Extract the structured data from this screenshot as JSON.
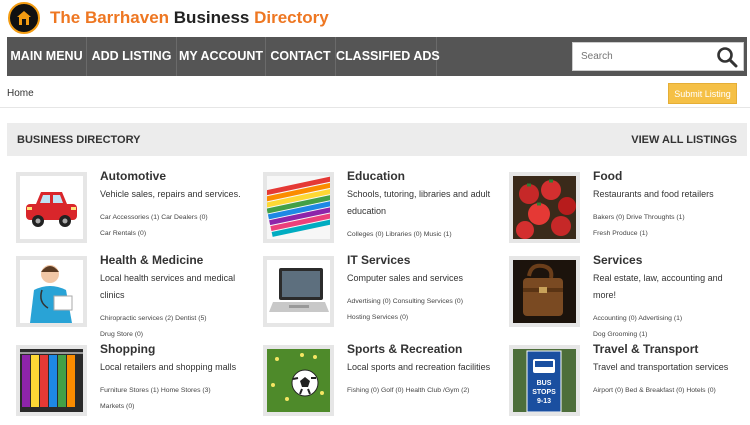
{
  "brand": {
    "title_part1": "The Barrhaven",
    "title_part2": "Business",
    "title_part3": "Directory",
    "colors": {
      "accent": "#ee7722",
      "nav_bg": "#555555",
      "submit_bg": "#f5c046"
    }
  },
  "nav": {
    "items": [
      "MAIN MENU",
      "ADD LISTING",
      "MY ACCOUNT",
      "CONTACT",
      "CLASSIFIED ADS"
    ],
    "search_placeholder": "Search"
  },
  "breadcrumb": "Home",
  "submit_label": "Submit Listing",
  "directory": {
    "heading": "BUSINESS DIRECTORY",
    "view_all": "VIEW ALL LISTINGS",
    "categories": [
      {
        "title": "Automotive",
        "desc": "Vehicle sales, repairs and services.",
        "subs": [
          "Car Accessories (1)",
          "Car Dealers (0)",
          "Car Rentals (0)"
        ],
        "icon": "car-icon"
      },
      {
        "title": "Education",
        "desc": "Schools, tutoring, libraries and adult education",
        "subs": [
          "Colleges (0)",
          "Libraries (0)",
          "Music (1)"
        ],
        "icon": "pencils-icon"
      },
      {
        "title": "Food",
        "desc": "Restaurants and food retailers",
        "subs": [
          "Bakers (0)",
          "Drive Throughts (1)",
          "Fresh Produce (1)"
        ],
        "icon": "tomatoes-icon"
      },
      {
        "title": "Health & Medicine",
        "desc": "Local health services and medical clinics",
        "subs": [
          "Chiropractic services (2)",
          "Dentist (5)",
          "Drug Store (0)"
        ],
        "icon": "nurse-icon"
      },
      {
        "title": "IT Services",
        "desc": "Computer sales and services",
        "subs": [
          "Advertising (0)",
          "Consulting Services (0)",
          "Hosting Services (0)"
        ],
        "icon": "laptop-icon"
      },
      {
        "title": "Services",
        "desc": "Real estate, law, accounting and more!",
        "subs": [
          "Accounting (0)",
          "Advertising (1)",
          "Dog Grooming (1)"
        ],
        "icon": "briefcase-icon"
      },
      {
        "title": "Shopping",
        "desc": "Local retailers and shopping malls",
        "subs": [
          "Furniture Stores (1)",
          "Home Stores (3)",
          "Markets (0)"
        ],
        "icon": "clothing-icon"
      },
      {
        "title": "Sports & Recreation",
        "desc": "Local sports and recreation facilities",
        "subs": [
          "Fishing (0)",
          "Golf (0)",
          "Health Club /Gym (2)"
        ],
        "icon": "soccer-ball-icon"
      },
      {
        "title": "Travel & Transport",
        "desc": "Travel and transportation services",
        "subs": [
          "Airport (0)",
          "Bed & Breakfast (0)",
          "Hotels (0)"
        ],
        "icon": "bus-stop-icon",
        "sign_text": [
          "BUS",
          "STOPS",
          "9-13"
        ]
      }
    ]
  }
}
